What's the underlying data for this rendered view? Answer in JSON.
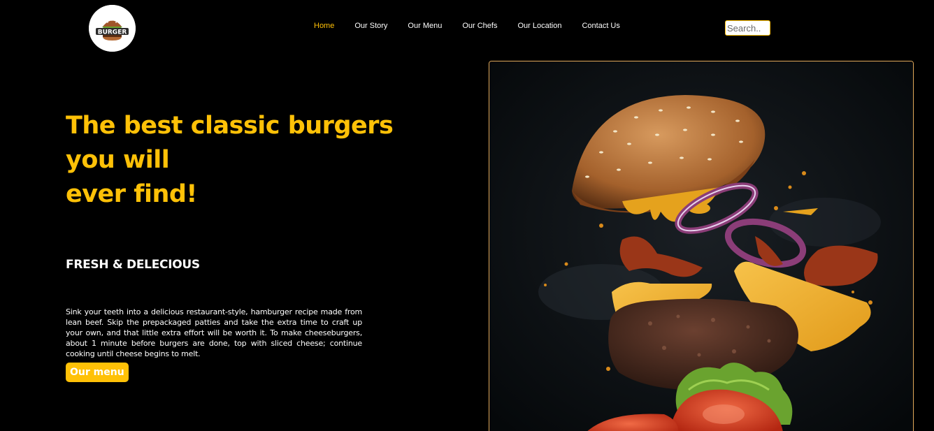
{
  "header": {
    "logo_text": "BURGER",
    "nav": [
      {
        "label": "Home",
        "active": true
      },
      {
        "label": "Our Story",
        "active": false
      },
      {
        "label": "Our Menu",
        "active": false
      },
      {
        "label": "Our Chefs",
        "active": false
      },
      {
        "label": "Our Location",
        "active": false
      },
      {
        "label": "Contact Us",
        "active": false
      }
    ],
    "search": {
      "placeholder": "Search..",
      "value": ""
    }
  },
  "hero": {
    "headline_lines": [
      "The best classic burgers",
      "you will",
      "ever find!"
    ],
    "subheading": "FRESH & DELECIOUS",
    "description": "Sink your teeth into a delicious restaurant-style, hamburger recipe made from lean beef. Skip the prepackaged patties and take the extra time to craft up your own, and that little extra effort will be worth it. To make cheeseburgers, about 1 minute before burgers are done, top with sliced cheese; continue cooking until cheese begins to melt.",
    "cta_label": "Our menu",
    "image": "flying-burger-photo"
  },
  "colors": {
    "accent": "#ffc107",
    "background": "#000000",
    "text": "#ffffff",
    "image_border": "#e0a85a"
  }
}
